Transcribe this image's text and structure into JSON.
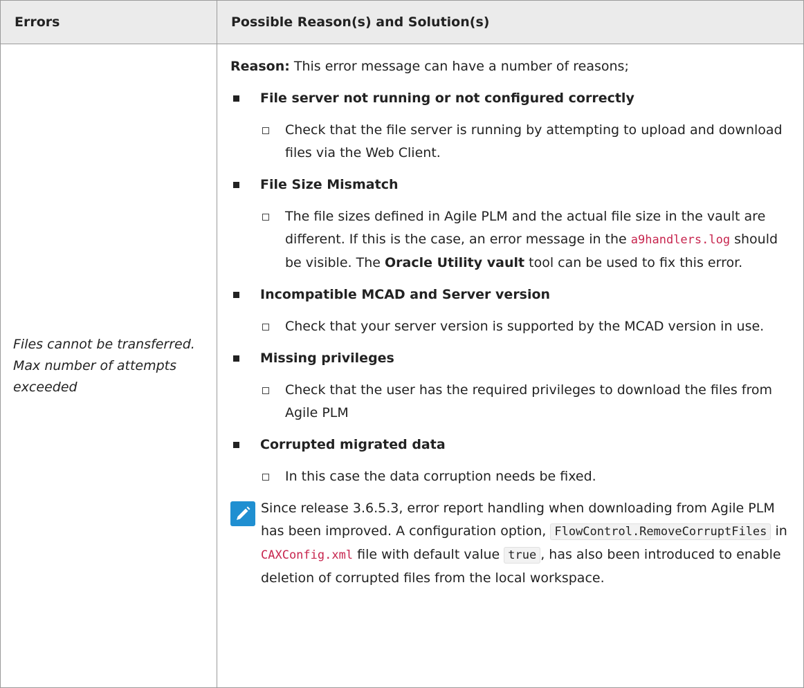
{
  "table": {
    "headers": [
      "Errors",
      "Possible Reason(s) and Solution(s)"
    ],
    "error_text": "Files cannot be transferred. Max number of attempts exceeded",
    "reason_label": "Reason:",
    "reason_text": " This error message can have a number of reasons;",
    "items": [
      {
        "title": "File server not running or not configured correctly",
        "sub": "Check that the file server is running by attempting to upload and download files via the Web Client."
      },
      {
        "title": "File Size Mismatch",
        "sub_parts": {
          "a": "The file sizes defined in Agile PLM and the actual file size in the vault are different. If this is the case, an error message in the ",
          "code": "a9handlers.log",
          "b": " should be visible. The ",
          "bold": "Oracle Utility vault",
          "c": " tool can be used to fix this error."
        }
      },
      {
        "title": "Incompatible MCAD and Server version",
        "sub": "Check that your server version is supported by the MCAD version in use."
      },
      {
        "title": "Missing privileges",
        "sub": "Check that the user has the required privileges to download the files from Agile PLM"
      },
      {
        "title": "Corrupted migrated data",
        "sub": "In this case the data corruption needs be fixed."
      }
    ],
    "note": {
      "icon": "pencil-note-icon",
      "text1": "Since release 3.6.5.3, error report handling when downloading from Agile PLM has been improved. A configuration option, ",
      "code1": "FlowControl.RemoveCorruptFiles",
      "text2": " in ",
      "code2": "CAXConfig.xml",
      "text3": " file with default value ",
      "code3": "true",
      "text4": ", has also been introduced to enable deletion of corrupted files from the local workspace."
    }
  },
  "colors": {
    "header_bg": "#ebebeb",
    "note_icon": "#1f8fd1",
    "code_red": "#c7254e"
  }
}
